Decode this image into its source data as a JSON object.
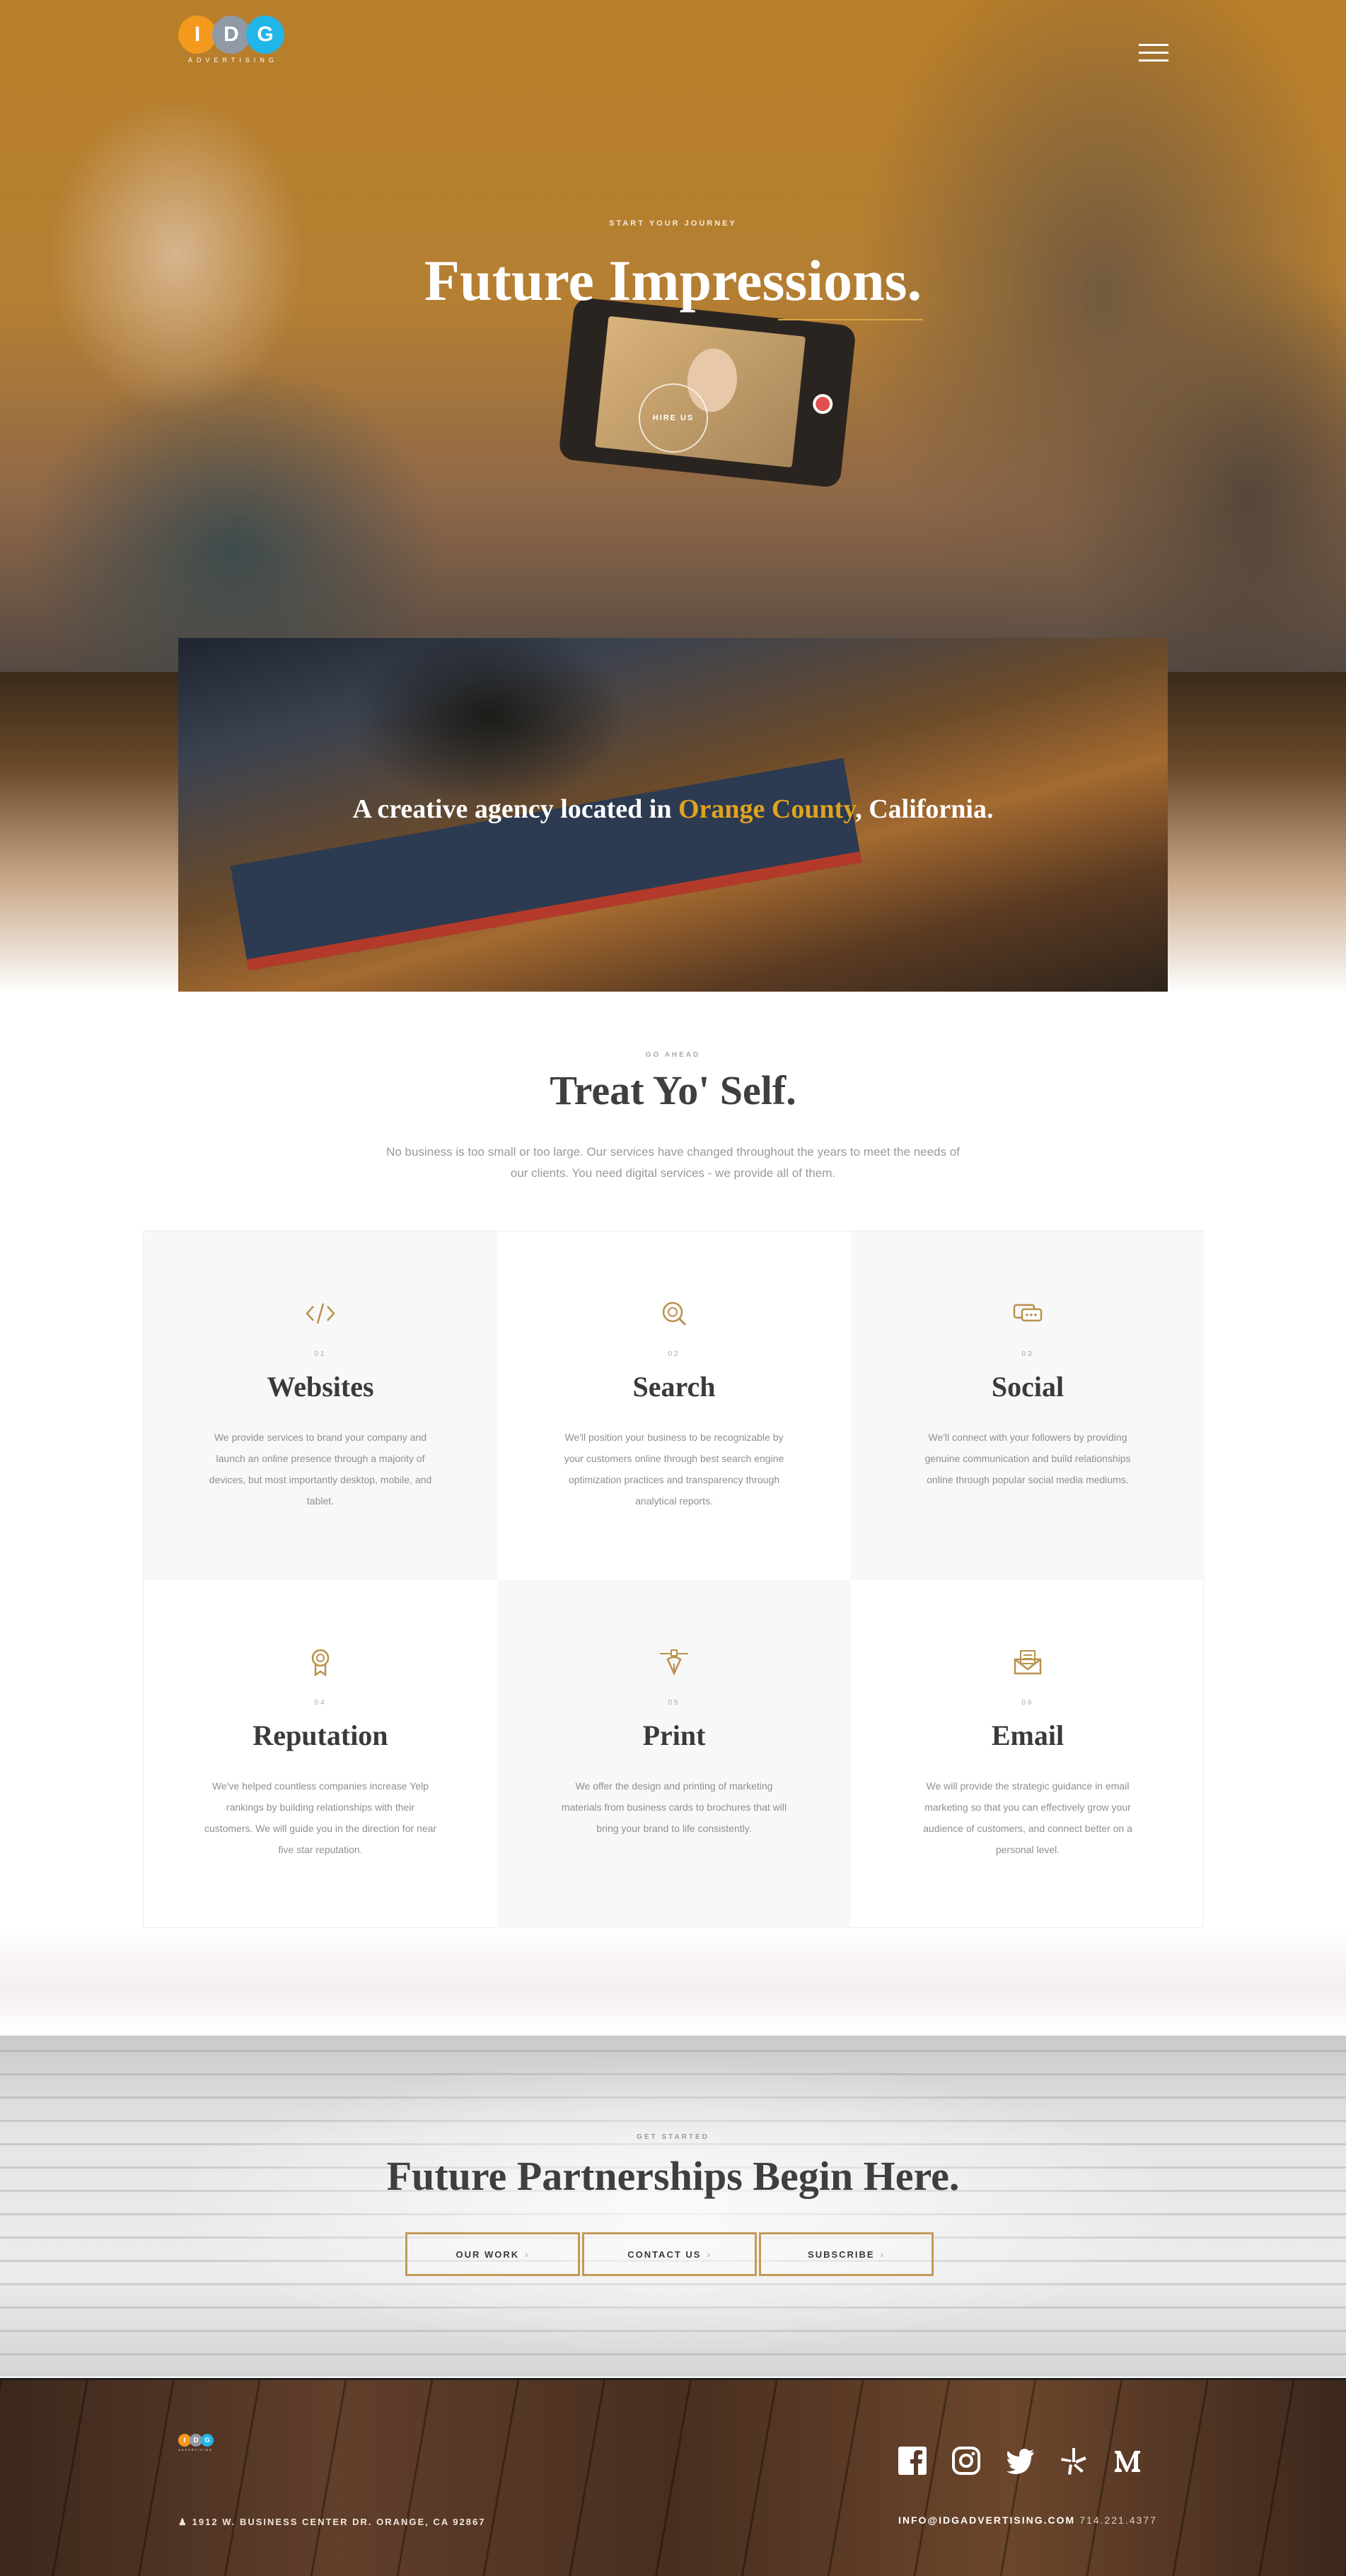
{
  "header": {
    "logo": {
      "letters": [
        "I",
        "D",
        "G"
      ],
      "subtitle": "ADVERTISING"
    },
    "menu_icon": "hamburger-icon"
  },
  "hero": {
    "kicker": "START YOUR JOURNEY",
    "title": "Future Impressions.",
    "cta_label": "HIRE US"
  },
  "band": {
    "text_before": "A creative agency located in ",
    "highlight": "Orange County",
    "text_after": ", California.",
    "highlight_color": "#e0a31c"
  },
  "services": {
    "kicker": "GO AHEAD",
    "title": "Treat Yo' Self.",
    "description": "No business is too small or too large. Our services have changed throughout the years to meet the needs of our clients. You need digital services - we provide all of them.",
    "items": [
      {
        "num": "01",
        "title": "Websites",
        "icon": "code-icon",
        "desc": "We provide services to brand your company and launch an online presence through a majority of devices, but most importantly desktop, mobile, and tablet."
      },
      {
        "num": "02",
        "title": "Search",
        "icon": "search-target-icon",
        "desc": "We'll position your business to be recognizable by your customers online through best search engine optimization practices and transparency through analytical reports."
      },
      {
        "num": "03",
        "title": "Social",
        "icon": "chat-bubbles-icon",
        "desc": "We'll connect with your followers by providing genuine communication and build relationships online through popular social media mediums."
      },
      {
        "num": "04",
        "title": "Reputation",
        "icon": "award-ribbon-icon",
        "desc": "We've helped countless companies increase Yelp rankings by building relationships with their customers. We will guide you in the direction for near five star reputation."
      },
      {
        "num": "05",
        "title": "Print",
        "icon": "pen-tool-icon",
        "desc": "We offer the design and printing of marketing materials from business cards to brochures that will bring your brand to life consistently."
      },
      {
        "num": "06",
        "title": "Email",
        "icon": "envelope-letter-icon",
        "desc": "We will provide the strategic guidance in email marketing so that you can effectively grow your audience of customers, and connect better on a personal level."
      }
    ]
  },
  "cta": {
    "kicker": "GET STARTED",
    "title": "Future Partnerships Begin Here.",
    "buttons": [
      {
        "label": "OUR WORK"
      },
      {
        "label": "CONTACT US"
      },
      {
        "label": "SUBSCRIBE"
      }
    ],
    "accent_color": "#c39a57"
  },
  "footer": {
    "address": "1912 W. BUSINESS CENTER DR. ORANGE, CA 92867",
    "email": "INFO@IDGADVERTISING.COM",
    "phone": "714.221.4377",
    "social": [
      "facebook-icon",
      "instagram-icon",
      "twitter-icon",
      "yelp-icon",
      "medium-icon"
    ]
  },
  "colors": {
    "logo_orange": "#f39a1e",
    "logo_gray": "#8f9aa6",
    "logo_blue": "#22b5e8",
    "gold": "#c39a57"
  }
}
